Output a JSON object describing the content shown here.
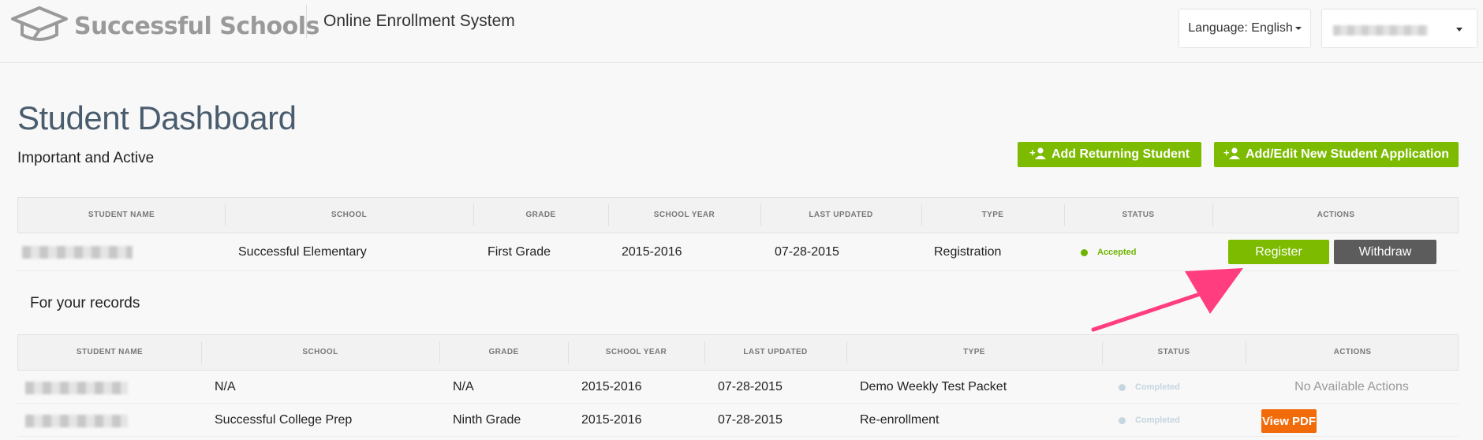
{
  "header": {
    "logo_text": "Successful Schools",
    "app_title": "Online Enrollment System",
    "language_label": "Language:",
    "language_value": "English",
    "user_menu_value": ""
  },
  "page": {
    "title": "Student Dashboard"
  },
  "active_section": {
    "title": "Important and Active",
    "add_returning_label": "Add Returning Student",
    "add_new_label": "Add/Edit New Student Application",
    "columns": [
      "Student Name",
      "School",
      "Grade",
      "School Year",
      "Last Updated",
      "Type",
      "Status",
      "Actions"
    ],
    "rows": [
      {
        "student_name": "",
        "school": "Successful Elementary",
        "grade": "First Grade",
        "school_year": "2015-2016",
        "last_updated": "07-28-2015",
        "type": "Registration",
        "status": "Accepted",
        "register_label": "Register",
        "withdraw_label": "Withdraw"
      }
    ]
  },
  "records_section": {
    "title": "For your records",
    "columns": [
      "Student Name",
      "School",
      "Grade",
      "School Year",
      "Last Updated",
      "Type",
      "Status",
      "Actions"
    ],
    "rows": [
      {
        "student_name": "",
        "school": "N/A",
        "grade": "N/A",
        "school_year": "2015-2016",
        "last_updated": "07-28-2015",
        "type": "Demo Weekly Test Packet",
        "status": "Completed",
        "action_text": "No Available Actions"
      },
      {
        "student_name": "",
        "school": "Successful College Prep",
        "grade": "Ninth Grade",
        "school_year": "2015-2016",
        "last_updated": "07-28-2015",
        "type": "Re-enrollment",
        "status": "Completed",
        "action_label": "View PDF"
      }
    ]
  },
  "colors": {
    "accent_green": "#7cbb00",
    "withdraw_gray": "#5c5c5c",
    "pdf_orange": "#f26b0a",
    "status_accepted": "#6fb300",
    "status_completed": "#c5d6e0",
    "annotation_arrow": "#ff3d7f"
  },
  "icons": {
    "logo": "graduation-cap-icon",
    "add_user": "add-user-icon",
    "dropdown": "chevron-down-icon"
  }
}
